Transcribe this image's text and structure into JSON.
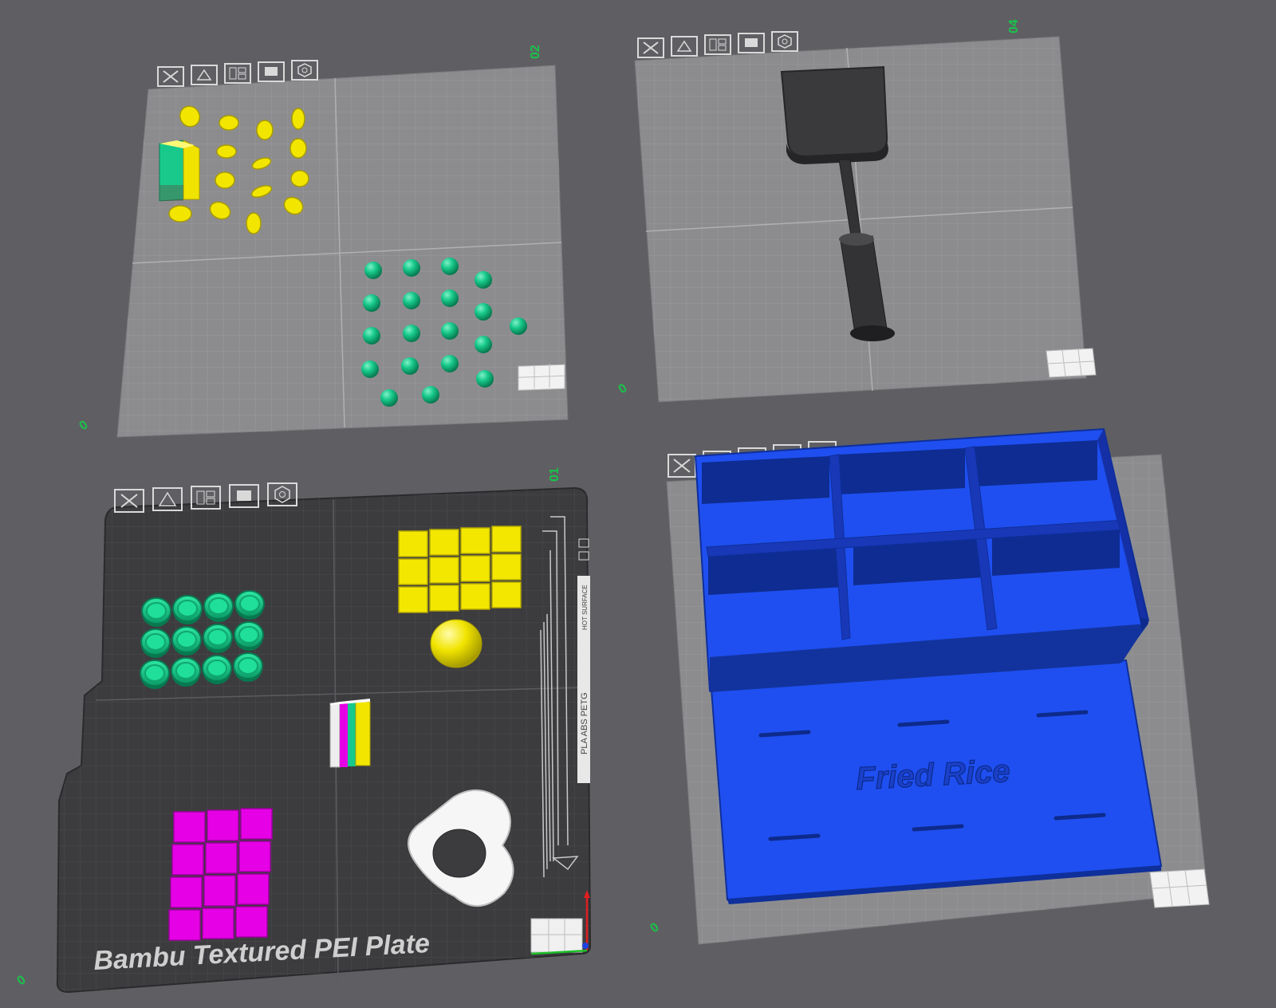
{
  "app": {
    "view": "3D plate overview"
  },
  "colors": {
    "background": "#5f5f63",
    "plate_light": "#8c8c8f",
    "plate_dark": "#3c3c3f",
    "grid_light": "#9d9da0",
    "grid_dark": "#4c4c50",
    "plate_number": "#19c34a",
    "yellow": "#f2e600",
    "green": "#17c98a",
    "magenta": "#e600e6",
    "blue": "#1f4ff0",
    "spatula": "#3a3a3c",
    "white": "#f4f4f4"
  },
  "plates": [
    {
      "id": "plate-2",
      "number_label": "02",
      "origin_label": "0",
      "toolbar_icons": [
        "close-icon",
        "auto-orient-icon",
        "arrange-icon",
        "lock-icon",
        "settings-icon"
      ],
      "objects": [
        "yellow corn pieces",
        "green-yellow block",
        "green spheres"
      ]
    },
    {
      "id": "plate-4",
      "number_label": "04",
      "origin_label": "0",
      "toolbar_icons": [
        "close-icon",
        "auto-orient-icon",
        "arrange-icon",
        "lock-icon",
        "settings-icon"
      ],
      "objects": [
        "spatula"
      ]
    },
    {
      "id": "plate-1",
      "number_label": "01",
      "origin_label": "0",
      "plate_name": "Bambu Textured PEI Plate",
      "side_text_1": "PLA ABS PETG",
      "side_text_2": "HOT SURFACE",
      "toolbar_icons": [
        "close-icon",
        "auto-orient-icon",
        "arrange-icon",
        "lock-icon",
        "settings-icon"
      ],
      "objects": [
        "green discs",
        "yellow tiles",
        "yellow dome",
        "striped bar",
        "magenta tiles",
        "fried egg"
      ]
    },
    {
      "id": "plate-3",
      "number_label": "",
      "origin_label": "0",
      "embossed_text": "Fried Rice",
      "toolbar_icons": [
        "close-icon",
        "auto-orient-icon",
        "arrange-icon",
        "lock-icon",
        "settings-icon"
      ],
      "objects": [
        "blue compartment box",
        "blue lid"
      ]
    }
  ]
}
